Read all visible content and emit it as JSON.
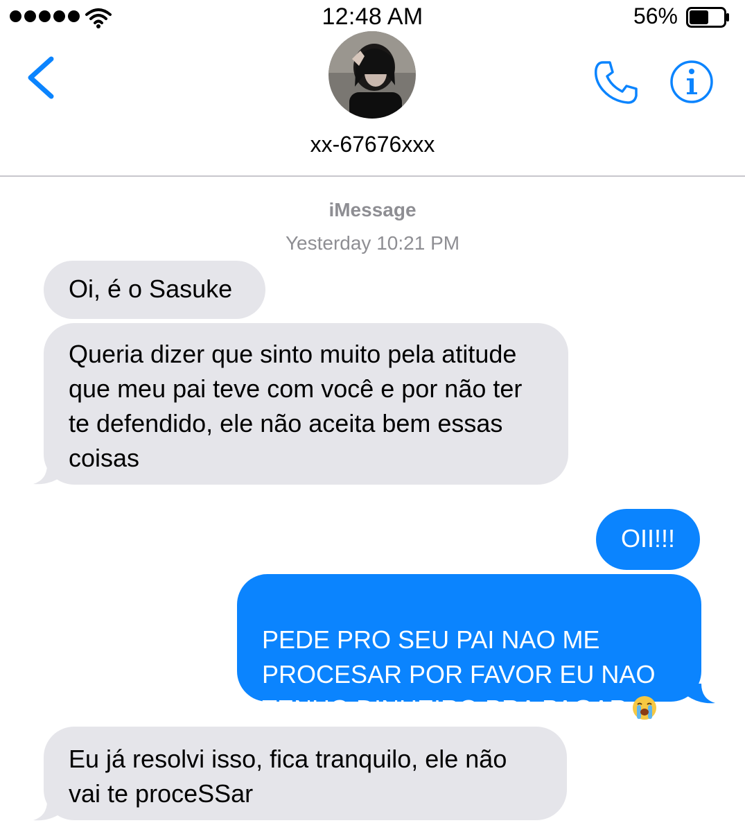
{
  "status_bar": {
    "time": "12:48 AM",
    "battery_percent": "56%",
    "battery_level": 0.56,
    "signal_bars": 5
  },
  "header": {
    "contact_name": "xx-67676xxx",
    "back_icon": "chevron-left-icon",
    "call_icon": "phone-icon",
    "info_icon": "info-icon",
    "accent_color": "#0b84fe"
  },
  "conversation": {
    "service": "iMessage",
    "timestamp": "Yesterday 10:21 PM",
    "messages": [
      {
        "direction": "received",
        "text": "Oi, é o Sasuke"
      },
      {
        "direction": "received",
        "text": "Queria dizer que sinto muito pela atitude que meu pai teve com você e por não ter te defendido, ele não aceita bem essas coisas"
      },
      {
        "direction": "sent",
        "text": "OII!!!"
      },
      {
        "direction": "sent",
        "text": "PEDE PRO SEU PAI NAO ME PROCESAR POR FAVOR EU NAO TENHO DINHEIRO PRA PAGAR",
        "emoji": "loudly-crying-face"
      },
      {
        "direction": "received",
        "text": "Eu já resolvi isso, fica tranquilo, ele não vai te proceSSar"
      }
    ]
  },
  "colors": {
    "sent_bubble": "#0b84fe",
    "received_bubble": "#e5e5ea",
    "meta_text": "#8e8e93"
  }
}
